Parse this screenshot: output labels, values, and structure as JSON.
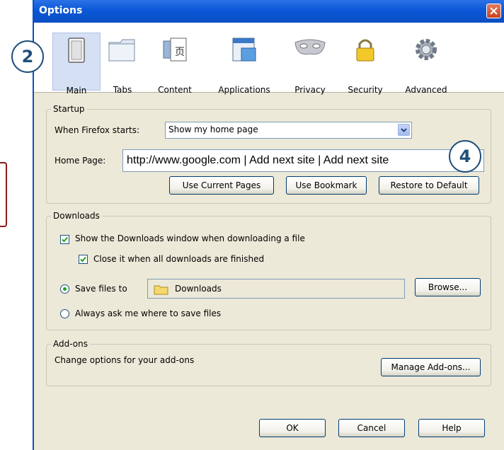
{
  "window": {
    "title": "Options"
  },
  "toolbar": {
    "tabs": [
      {
        "label": "Main",
        "icon": "switch-icon"
      },
      {
        "label": "Tabs",
        "icon": "tabs-icon"
      },
      {
        "label": "Content",
        "icon": "content-icon"
      },
      {
        "label": "Applications",
        "icon": "applications-icon"
      },
      {
        "label": "Privacy",
        "icon": "mask-icon"
      },
      {
        "label": "Security",
        "icon": "lock-icon"
      },
      {
        "label": "Advanced",
        "icon": "gear-icon"
      }
    ],
    "selected": "Main"
  },
  "startup": {
    "title": "Startup",
    "when_label": "When Firefox starts:",
    "when_value": "Show my home page",
    "home_label": "Home Page:",
    "home_value": "http://www.google.com | Add next site | Add next site",
    "btn_current": "Use Current Pages",
    "btn_bookmark": "Use Bookmark",
    "btn_restore": "Restore to Default"
  },
  "downloads": {
    "title": "Downloads",
    "show_window": "Show the Downloads window when downloading a file",
    "close_it": "Close it when all downloads are finished",
    "save_to": "Save files to",
    "folder": "Downloads",
    "browse": "Browse...",
    "always_ask": "Always ask me where to save files"
  },
  "addons": {
    "title": "Add-ons",
    "desc": "Change options for your add-ons",
    "manage": "Manage Add-ons..."
  },
  "footer": {
    "ok": "OK",
    "cancel": "Cancel",
    "help": "Help"
  },
  "callouts": {
    "a": "2",
    "b": "4"
  }
}
